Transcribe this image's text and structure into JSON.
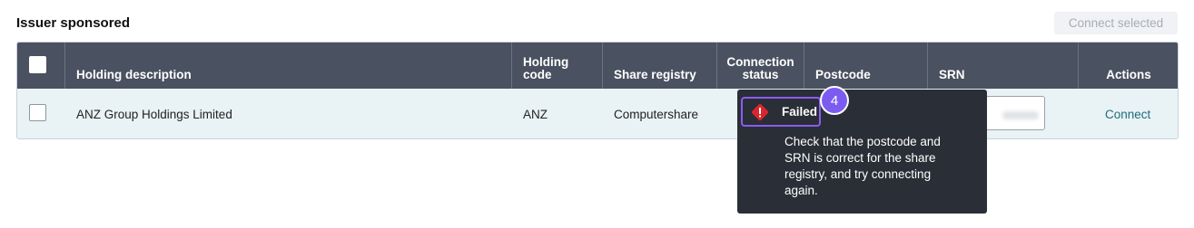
{
  "section": {
    "title": "Issuer sponsored",
    "connect_selected_label": "Connect selected"
  },
  "columns": {
    "holding_description": "Holding description",
    "holding_code_line1": "Holding",
    "holding_code_line2": "code",
    "share_registry": "Share registry",
    "connection_status_line1": "Connection",
    "connection_status_line2": "status",
    "postcode": "Postcode",
    "srn": "SRN",
    "actions": "Actions"
  },
  "rows": [
    {
      "holding_description": "ANZ Group Holdings Limited",
      "holding_code": "ANZ",
      "share_registry": "Computershare",
      "connection_status": "Failed",
      "action_label": "Connect"
    }
  ],
  "tooltip": {
    "status": "Failed",
    "message": "Check that the postcode and SRN is correct for the share registry, and try connecting again."
  },
  "badge": {
    "number": "4"
  },
  "colors": {
    "header_bg": "#4a5160",
    "row_bg": "#e9f2f4",
    "tooltip_bg": "#2a2e36",
    "accent": "#8b5cf6",
    "error": "#d9262c",
    "link": "#1f6e7a"
  },
  "icons": {
    "status_icon": "error-diamond-icon"
  }
}
